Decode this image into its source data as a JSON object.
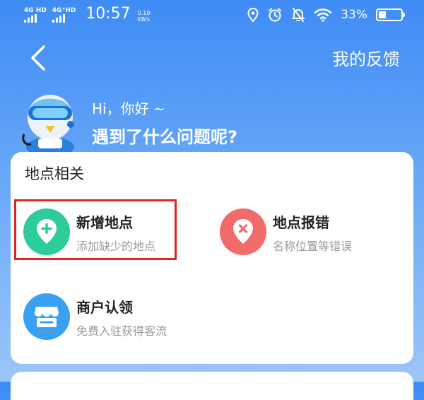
{
  "status_bar": {
    "network_1": "4G HD",
    "network_2": "4G⁺HD",
    "time": "10:57",
    "speed_value": "0.10",
    "speed_unit": "KB/s",
    "battery_pct": "33%",
    "battery_level": 0.33
  },
  "header": {
    "feedback_link": "我的反馈"
  },
  "greeting": {
    "hi": "Hi，你好 ~",
    "question": "遇到了什么问题呢?"
  },
  "section": {
    "title": "地点相关",
    "items": [
      {
        "title": "新增地点",
        "subtitle": "添加缺少的地点",
        "icon": "add-location-icon",
        "color": "#2ecc9b",
        "highlighted": true
      },
      {
        "title": "地点报错",
        "subtitle": "名称位置等错误",
        "icon": "location-error-icon",
        "color": "#f26b6b",
        "highlighted": false
      },
      {
        "title": "商户认领",
        "subtitle": "免费入驻获得客流",
        "icon": "store-icon",
        "color": "#3aa0f2",
        "highlighted": false
      }
    ]
  },
  "colors": {
    "background_top": "#3f8cf5",
    "highlight_border": "#e0271f"
  }
}
